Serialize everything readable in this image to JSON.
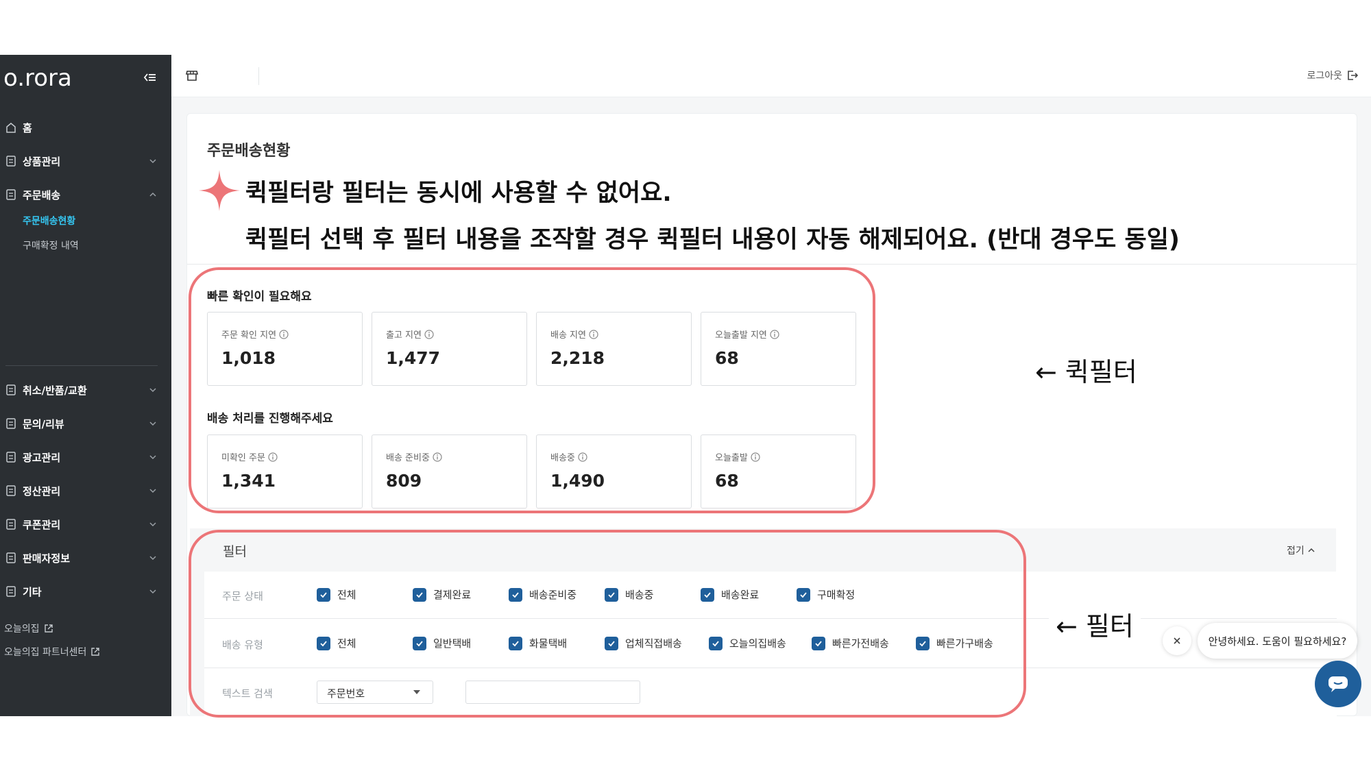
{
  "sidebar": {
    "logo": "o.rora",
    "items": [
      {
        "label": "홈"
      },
      {
        "label": "상품관리"
      },
      {
        "label": "주문배송"
      },
      {
        "label": "취소/반품/교환"
      },
      {
        "label": "문의/리뷰"
      },
      {
        "label": "광고관리"
      },
      {
        "label": "정산관리"
      },
      {
        "label": "쿠폰관리"
      },
      {
        "label": "판매자정보"
      },
      {
        "label": "기타"
      }
    ],
    "sub_items": [
      {
        "label": "주문배송현황"
      },
      {
        "label": "구매확정 내역"
      }
    ],
    "links": [
      {
        "label": "오늘의집"
      },
      {
        "label": "오늘의집 파트너센터"
      }
    ]
  },
  "topbar": {
    "logout_label": "로그아웃"
  },
  "page": {
    "title": "주문배송현황",
    "notice_line1": "퀵필터랑 필터는 동시에 사용할 수 없어요.",
    "notice_line2": "퀵필터 선택 후 필터 내용을 조작할 경우 퀵필터 내용이 자동 해제되어요. (반대 경우도 동일)"
  },
  "quick_filter": {
    "section1_title": "빠른 확인이 필요해요",
    "section1": [
      {
        "label": "주문 확인 지연",
        "value": "1,018"
      },
      {
        "label": "출고 지연",
        "value": "1,477"
      },
      {
        "label": "배송 지연",
        "value": "2,218"
      },
      {
        "label": "오늘출발 지연",
        "value": "68"
      }
    ],
    "section2_title": "배송 처리를 진행해주세요",
    "section2": [
      {
        "label": "미확인 주문",
        "value": "1,341"
      },
      {
        "label": "배송 준비중",
        "value": "809"
      },
      {
        "label": "배송중",
        "value": "1,490"
      },
      {
        "label": "오늘출발",
        "value": "68"
      }
    ]
  },
  "annotations": {
    "quick_filter_label": "← 퀵필터",
    "filter_label": "← 필터",
    "highlight_color": "#ec7578"
  },
  "filter": {
    "title": "필터",
    "fold_label": "접기",
    "order_status_label": "주문 상태",
    "order_status_options": [
      "전체",
      "결제완료",
      "배송준비중",
      "배송중",
      "배송완료",
      "구매확정"
    ],
    "delivery_type_label": "배송 유형",
    "delivery_type_options": [
      "전체",
      "일반택배",
      "화물택배",
      "업체직접배송",
      "오늘의집배송",
      "빠른가전배송",
      "빠른가구배송"
    ],
    "text_search_label": "텍스트 검색",
    "text_search_select": "주문번호",
    "text_search_value": ""
  },
  "chat": {
    "greeting": "안녕하세요. 도움이 필요하세요?"
  },
  "colors": {
    "sidebar_bg": "#2b2f33",
    "active_sub": "#35c5f0",
    "checkbox": "#1f5f9b"
  }
}
